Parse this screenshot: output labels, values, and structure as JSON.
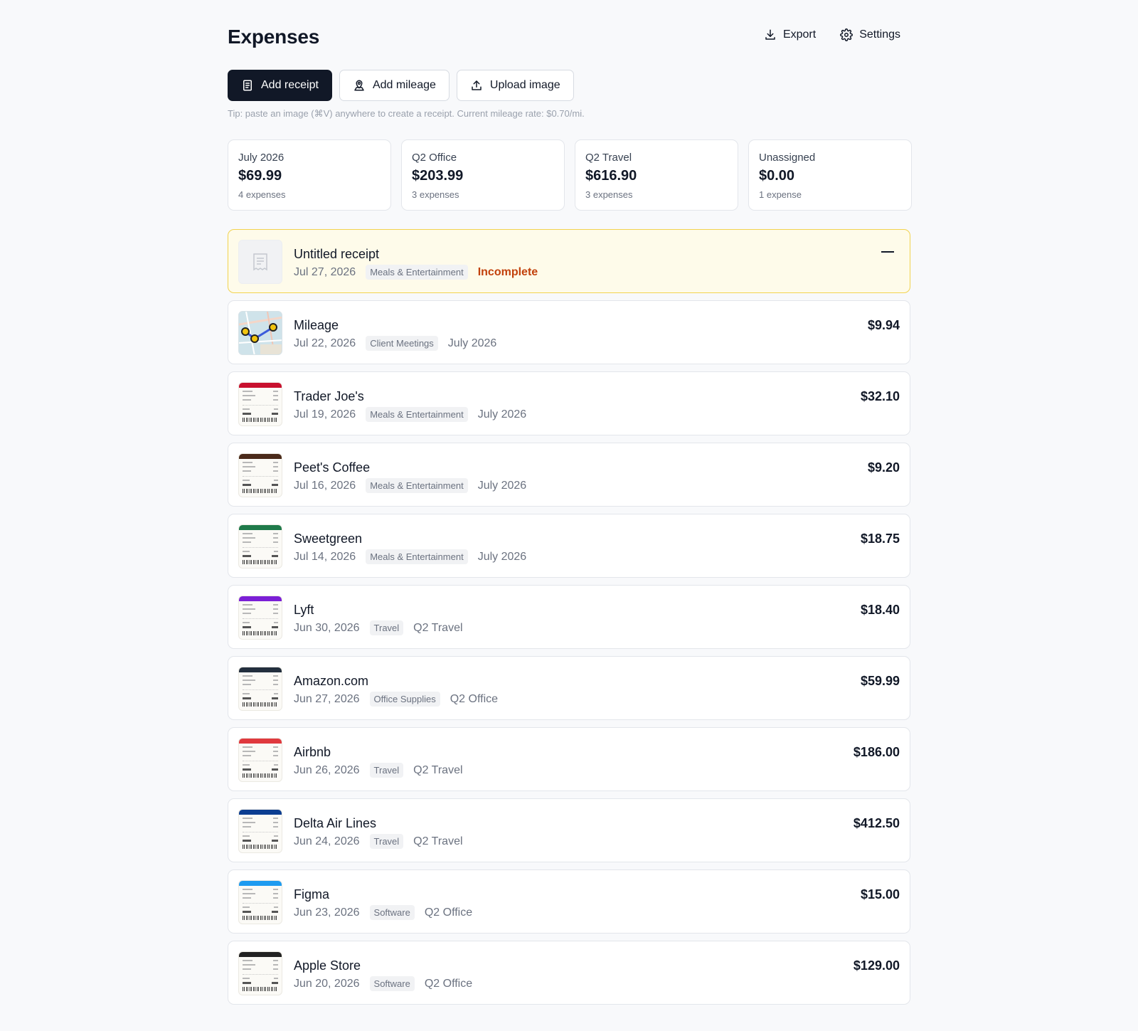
{
  "header": {
    "title": "Expenses",
    "export_label": "Export",
    "settings_label": "Settings"
  },
  "actions": {
    "add_receipt": "Add receipt",
    "add_mileage": "Add mileage",
    "upload_image": "Upload image",
    "tip": "Tip: paste an image (⌘V) anywhere to create a receipt. Current mileage rate: $0.70/mi."
  },
  "summary": [
    {
      "label": "July 2026",
      "amount": "$69.99",
      "count": "4 expenses"
    },
    {
      "label": "Q2 Office",
      "amount": "$203.99",
      "count": "3 expenses"
    },
    {
      "label": "Q2 Travel",
      "amount": "$616.90",
      "count": "3 expenses"
    },
    {
      "label": "Unassigned",
      "amount": "$0.00",
      "count": "1 expense"
    }
  ],
  "expenses": [
    {
      "title": "Untitled receipt",
      "date": "Jul 27, 2026",
      "category": "Meals & Entertainment",
      "status": "Incomplete",
      "report": "",
      "amount": "",
      "thumb": "placeholder",
      "color": ""
    },
    {
      "title": "Mileage",
      "date": "Jul 22, 2026",
      "category": "Client Meetings",
      "report": "July 2026",
      "amount": "$9.94",
      "thumb": "map",
      "color": ""
    },
    {
      "title": "Trader Joe's",
      "date": "Jul 19, 2026",
      "category": "Meals & Entertainment",
      "report": "July 2026",
      "amount": "$32.10",
      "thumb": "receipt",
      "color": "#c8102e"
    },
    {
      "title": "Peet's Coffee",
      "date": "Jul 16, 2026",
      "category": "Meals & Entertainment",
      "report": "July 2026",
      "amount": "$9.20",
      "thumb": "receipt",
      "color": "#4a2a1a"
    },
    {
      "title": "Sweetgreen",
      "date": "Jul 14, 2026",
      "category": "Meals & Entertainment",
      "report": "July 2026",
      "amount": "$18.75",
      "thumb": "receipt",
      "color": "#1f7a4a"
    },
    {
      "title": "Lyft",
      "date": "Jun 30, 2026",
      "category": "Travel",
      "report": "Q2 Travel",
      "amount": "$18.40",
      "thumb": "receipt",
      "color": "#7b1fd6"
    },
    {
      "title": "Amazon.com",
      "date": "Jun 27, 2026",
      "category": "Office Supplies",
      "report": "Q2 Office",
      "amount": "$59.99",
      "thumb": "receipt",
      "color": "#232f3e"
    },
    {
      "title": "Airbnb",
      "date": "Jun 26, 2026",
      "category": "Travel",
      "report": "Q2 Travel",
      "amount": "$186.00",
      "thumb": "receipt",
      "color": "#e0393e"
    },
    {
      "title": "Delta Air Lines",
      "date": "Jun 24, 2026",
      "category": "Travel",
      "report": "Q2 Travel",
      "amount": "$412.50",
      "thumb": "receipt",
      "color": "#0b3d91"
    },
    {
      "title": "Figma",
      "date": "Jun 23, 2026",
      "category": "Software",
      "report": "Q2 Office",
      "amount": "$15.00",
      "thumb": "receipt",
      "color": "#1e9bf0"
    },
    {
      "title": "Apple Store",
      "date": "Jun 20, 2026",
      "category": "Software",
      "report": "Q2 Office",
      "amount": "$129.00",
      "thumb": "receipt",
      "color": "#222222"
    }
  ],
  "colors": {
    "primary": "#111827",
    "incomplete_bg": "#fefbea",
    "incomplete_border": "#f2d34f",
    "incomplete_text": "#c2410c"
  },
  "icons": {
    "export": "download-icon",
    "settings": "gear-icon",
    "add_receipt": "receipt-icon",
    "add_mileage": "map-pin-icon",
    "upload_image": "upload-icon",
    "collapse": "minus-icon"
  }
}
